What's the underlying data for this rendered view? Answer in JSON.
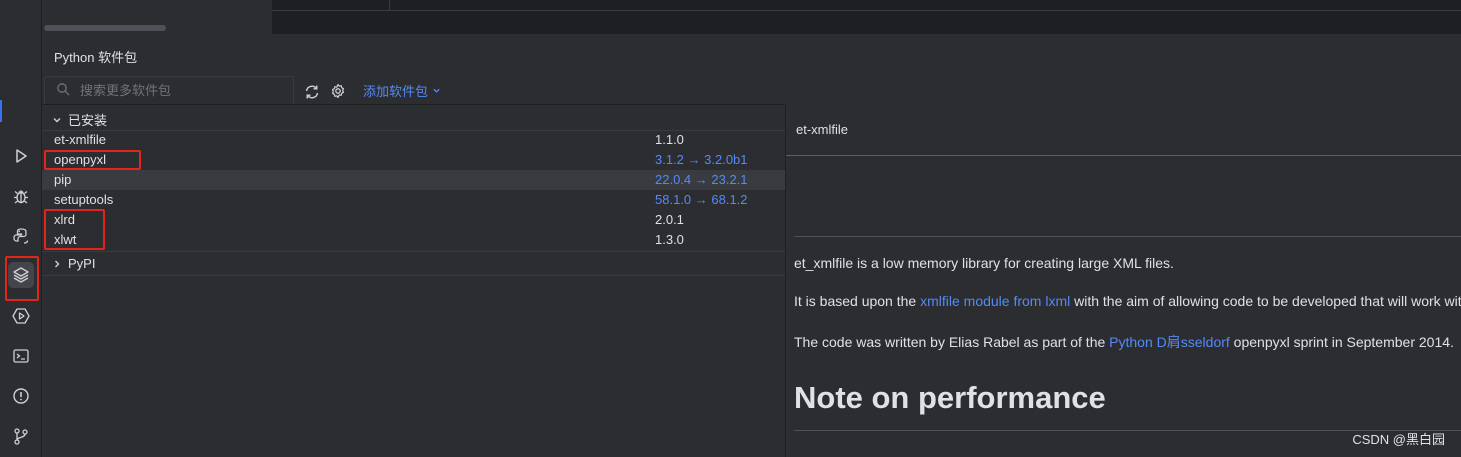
{
  "tool_window": {
    "title": "Python 软件包"
  },
  "toolbar": {
    "search_placeholder": "搜索更多软件包",
    "add_package_label": "添加软件包",
    "refresh_icon": "refresh-icon",
    "settings_icon": "gear-icon"
  },
  "installed": {
    "header": "已安装",
    "packages": [
      {
        "name": "et-xmlfile",
        "version": "1.1.0",
        "update": false
      },
      {
        "name": "openpyxl",
        "version": "3.1.2 → 3.2.0b1",
        "update": true
      },
      {
        "name": "pip",
        "version": "22.0.4 → 23.2.1",
        "update": true
      },
      {
        "name": "setuptools",
        "version": "58.1.0 → 68.1.2",
        "update": true
      },
      {
        "name": "xlrd",
        "version": "2.0.1",
        "update": false
      },
      {
        "name": "xlwt",
        "version": "1.3.0",
        "update": false
      }
    ]
  },
  "pypi": {
    "header": "PyPI"
  },
  "detail": {
    "title": "et-xmlfile",
    "p1": "et_xmlfile is a low memory library for creating large XML files.",
    "p2_before": "It is based upon the ",
    "p2_link": "xmlfile module from lxml",
    "p2_after": " with the aim of allowing code to be developed that will work with",
    "p3_before": "The code was written by Elias Rabel as part of the ",
    "p3_link": "Python D肩sseldorf",
    "p3_after": " openpyxl sprint in September 2014.",
    "heading": "Note on performance"
  },
  "watermark": "CSDN @黑白园",
  "colors": {
    "background": "#2b2d30",
    "link": "#548af7",
    "annotation_red": "#e0261b"
  }
}
